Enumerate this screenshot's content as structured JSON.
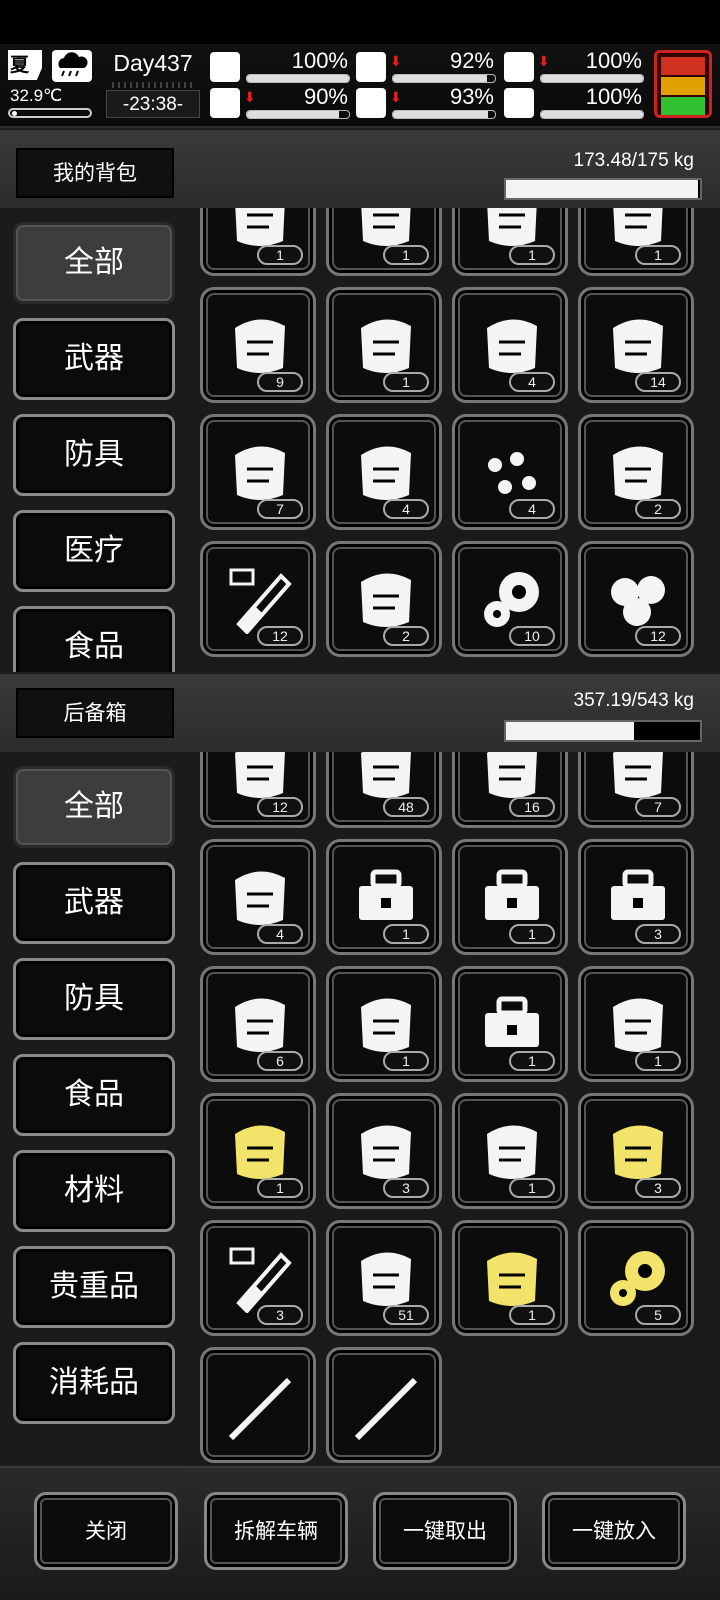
{
  "status": {
    "season": "夏",
    "temperature": "32.9℃",
    "day": "Day437",
    "time": "-23:38-",
    "stats": [
      {
        "name": "health",
        "icon": "medkit-icon",
        "value": "100%",
        "level": 100,
        "down": false
      },
      {
        "name": "hunger",
        "icon": "stomach-icon",
        "value": "92%",
        "level": 92,
        "down": true
      },
      {
        "name": "mood",
        "icon": "capsule-icon",
        "value": "100%",
        "level": 100,
        "down": true
      },
      {
        "name": "stamina",
        "icon": "boot-icon",
        "value": "90%",
        "level": 90,
        "down": true
      },
      {
        "name": "thirst",
        "icon": "water-drop-icon",
        "value": "93%",
        "level": 93,
        "down": true
      },
      {
        "name": "vitality",
        "icon": "heart-icon",
        "value": "100%",
        "level": 100,
        "down": false
      }
    ],
    "alarm_colors": [
      "#d03020",
      "#e0a000",
      "#30c030"
    ]
  },
  "backpack": {
    "title": "我的背包",
    "weight": "173.48/175 kg",
    "weight_fraction": 0.991,
    "categories": [
      {
        "label": "全部",
        "active": true
      },
      {
        "label": "武器",
        "active": false
      },
      {
        "label": "防具",
        "active": false
      },
      {
        "label": "医疗",
        "active": false
      },
      {
        "label": "食品",
        "active": false
      }
    ],
    "items": [
      {
        "icon": "cloth-bundle-icon",
        "count": "1"
      },
      {
        "icon": "battery-icon",
        "count": "1"
      },
      {
        "icon": "pizza-icon",
        "count": "1"
      },
      {
        "icon": "stew-bowl-icon",
        "count": "1"
      },
      {
        "icon": "torn-shirt-icon",
        "count": "9"
      },
      {
        "icon": "screws-icon",
        "count": "1"
      },
      {
        "icon": "soldering-iron-icon",
        "count": "4"
      },
      {
        "icon": "folded-cloth-icon",
        "count": "14"
      },
      {
        "icon": "tube-roll-icon",
        "count": "7"
      },
      {
        "icon": "pipe-fittings-icon",
        "count": "4"
      },
      {
        "icon": "berries-icon",
        "count": "4"
      },
      {
        "icon": "green-onion-icon",
        "count": "2"
      },
      {
        "icon": "vial-i-icon",
        "count": "12"
      },
      {
        "icon": "scrap-parts-icon",
        "count": "2"
      },
      {
        "icon": "gears-icon",
        "count": "10"
      },
      {
        "icon": "potatoes-icon",
        "count": "12"
      }
    ]
  },
  "storage": {
    "title": "后备箱",
    "weight": "357.19/543 kg",
    "weight_fraction": 0.658,
    "categories": [
      {
        "label": "全部",
        "active": true
      },
      {
        "label": "武器",
        "active": false
      },
      {
        "label": "防具",
        "active": false
      },
      {
        "label": "食品",
        "active": false
      },
      {
        "label": "材料",
        "active": false
      },
      {
        "label": "贵重品",
        "active": false
      },
      {
        "label": "消耗品",
        "active": false
      }
    ],
    "items": [
      {
        "icon": "shoe-icon",
        "count": "12"
      },
      {
        "icon": "fabric-sheet-icon",
        "count": "48"
      },
      {
        "icon": "cloth-roll-icon",
        "count": "16"
      },
      {
        "icon": "folded-paper-icon",
        "count": "7"
      },
      {
        "icon": "paper-roll-icon",
        "count": "4"
      },
      {
        "icon": "toolbox-icon",
        "count": "1"
      },
      {
        "icon": "toolbox-icon",
        "count": "1"
      },
      {
        "icon": "toolbox-icon",
        "count": "3"
      },
      {
        "icon": "bag-icon",
        "count": "6"
      },
      {
        "icon": "meat-icon",
        "count": "1"
      },
      {
        "icon": "toolbox-icon",
        "count": "1"
      },
      {
        "icon": "body-armor-icon",
        "count": "1"
      },
      {
        "icon": "yellow-sticks-icon",
        "count": "1"
      },
      {
        "icon": "bread-icon",
        "count": "3"
      },
      {
        "icon": "armor-vest-icon",
        "count": "1"
      },
      {
        "icon": "yellow-cloth-icon",
        "count": "3"
      },
      {
        "icon": "vial-vii-icon",
        "count": "3"
      },
      {
        "icon": "machine-parts-icon",
        "count": "51"
      },
      {
        "icon": "yellow-cylinder-icon",
        "count": "1"
      },
      {
        "icon": "yellow-gears-icon",
        "count": "5"
      },
      {
        "icon": "rifle-icon",
        "count": ""
      },
      {
        "icon": "spear-icon",
        "count": ""
      }
    ]
  },
  "footer": {
    "buttons": [
      "关闭",
      "拆解车辆",
      "一键取出",
      "一键放入"
    ]
  }
}
